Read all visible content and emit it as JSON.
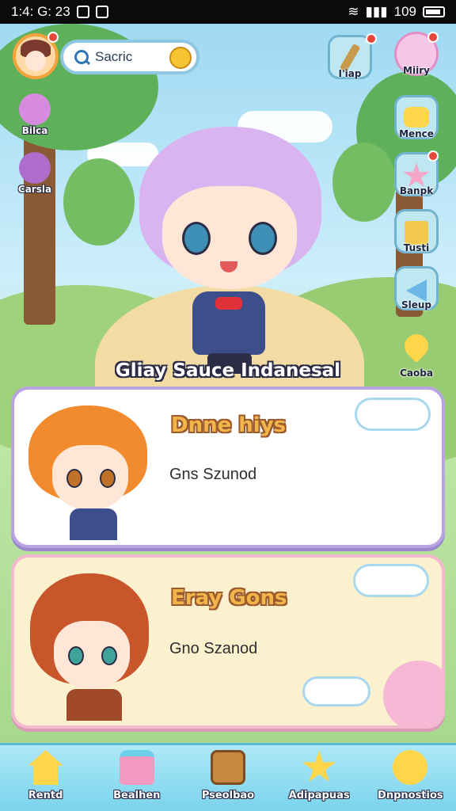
{
  "status_bar": {
    "time": "1:4: G: 23",
    "battery": "109"
  },
  "header": {
    "search_label": "Sacric"
  },
  "left_menu": [
    {
      "label": "Bilca",
      "icon": "pink-creature-icon"
    },
    {
      "label": "Carsla",
      "icon": "purple-creature-icon"
    }
  ],
  "right_menu": [
    {
      "label": "I'iap",
      "icon": "brush-icon"
    },
    {
      "label": "Miiry",
      "icon": "character-avatar-icon"
    },
    {
      "label": "Mence",
      "icon": "chat-bubble-icon"
    },
    {
      "label": "Banpk",
      "icon": "star-icon"
    },
    {
      "label": "Tusti",
      "icon": "box-icon"
    },
    {
      "label": "Sleup",
      "icon": "triangle-icon"
    },
    {
      "label": "Caoba",
      "icon": "heart-icon"
    }
  ],
  "scene": {
    "caption": "Gliay Sauce Indanesal"
  },
  "cards": [
    {
      "title": "Dnne hiys",
      "subtitle": "Gns Szunod"
    },
    {
      "title": "Eray Gons",
      "subtitle": "Gno Szanod"
    }
  ],
  "bottom_nav": [
    {
      "label": "Rentd",
      "icon": "home-icon"
    },
    {
      "label": "Bealhen",
      "icon": "bag-icon"
    },
    {
      "label": "Pseolbao",
      "icon": "chest-icon"
    },
    {
      "label": "Adipapuas",
      "icon": "star-icon"
    },
    {
      "label": "Dnpnostios",
      "icon": "chat-icon"
    }
  ],
  "colors": {
    "accent": "#f3a33b",
    "card1_border": "#b9a4e0",
    "card2_border": "#f2b9cf",
    "nav_bg": "#7ad3ec"
  }
}
